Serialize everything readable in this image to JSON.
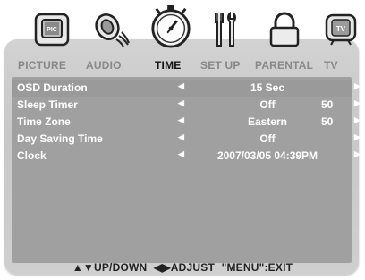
{
  "tabs": [
    {
      "label": "PICTURE",
      "icon": "picture-icon"
    },
    {
      "label": "AUDIO",
      "icon": "audio-icon"
    },
    {
      "label": "TIME",
      "icon": "clock-icon",
      "active": true
    },
    {
      "label": "SET UP",
      "icon": "setup-tools-icon"
    },
    {
      "label": "PARENTAL",
      "icon": "lock-icon"
    },
    {
      "label": "TV",
      "icon": "tv-icon"
    }
  ],
  "menu": [
    {
      "name": "OSD Duration",
      "value": "15 Sec",
      "num": ""
    },
    {
      "name": "Sleep Timer",
      "value": "Off",
      "num": "50"
    },
    {
      "name": "Time Zone",
      "value": "Eastern",
      "num": "50"
    },
    {
      "name": "Day Saving Time",
      "value": "Off",
      "num": ""
    },
    {
      "name": "Clock",
      "value": "2007/03/05 04:39PM",
      "num": ""
    }
  ],
  "footer": {
    "updown": "▲▼UP/DOWN",
    "adjust": "◀▶ADJUST",
    "exit": "\"MENU\":EXIT"
  },
  "glyphs": {
    "left_arrow": "◀",
    "right_arrow": "▶"
  }
}
